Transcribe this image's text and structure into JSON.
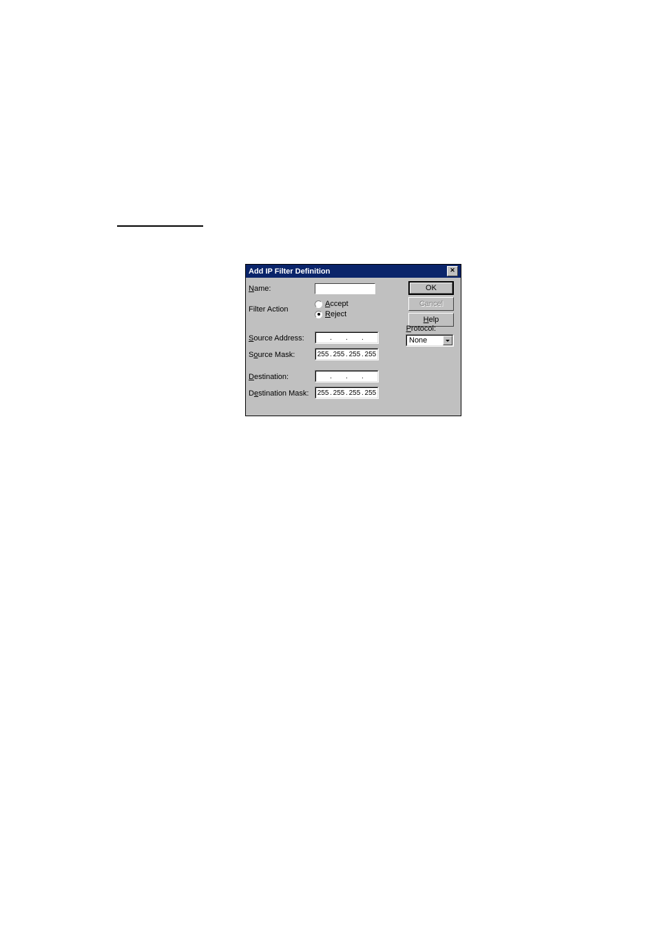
{
  "dialog": {
    "title": "Add IP Filter Definition",
    "labels": {
      "name": "Name:",
      "name_ul": "N",
      "filter_action": "Filter Action",
      "accept": "Accept",
      "accept_ul": "A",
      "reject": "Reject",
      "reject_ul": "R",
      "source_address": "Source Address:",
      "source_address_ul": "S",
      "source_mask": "Source Mask:",
      "source_mask_ul": "o",
      "destination": "Destination:",
      "destination_ul": "D",
      "destination_mask": "Destination Mask:",
      "destination_mask_ul": "e",
      "protocol": "Protocol:",
      "protocol_ul": "P"
    },
    "values": {
      "name_value": "",
      "source_address_value": ". . .",
      "source_mask_oct1": "255",
      "source_mask_oct2": "255",
      "source_mask_oct3": "255",
      "source_mask_oct4": "255",
      "destination_value": ". . .",
      "dest_mask_oct1": "255",
      "dest_mask_oct2": "255",
      "dest_mask_oct3": "255",
      "dest_mask_oct4": "255",
      "protocol_selected": "None",
      "reject_selected": true,
      "accept_selected": false
    },
    "buttons": {
      "ok": "OK",
      "cancel": "Cancel",
      "help": "Help",
      "help_ul": "H"
    }
  }
}
